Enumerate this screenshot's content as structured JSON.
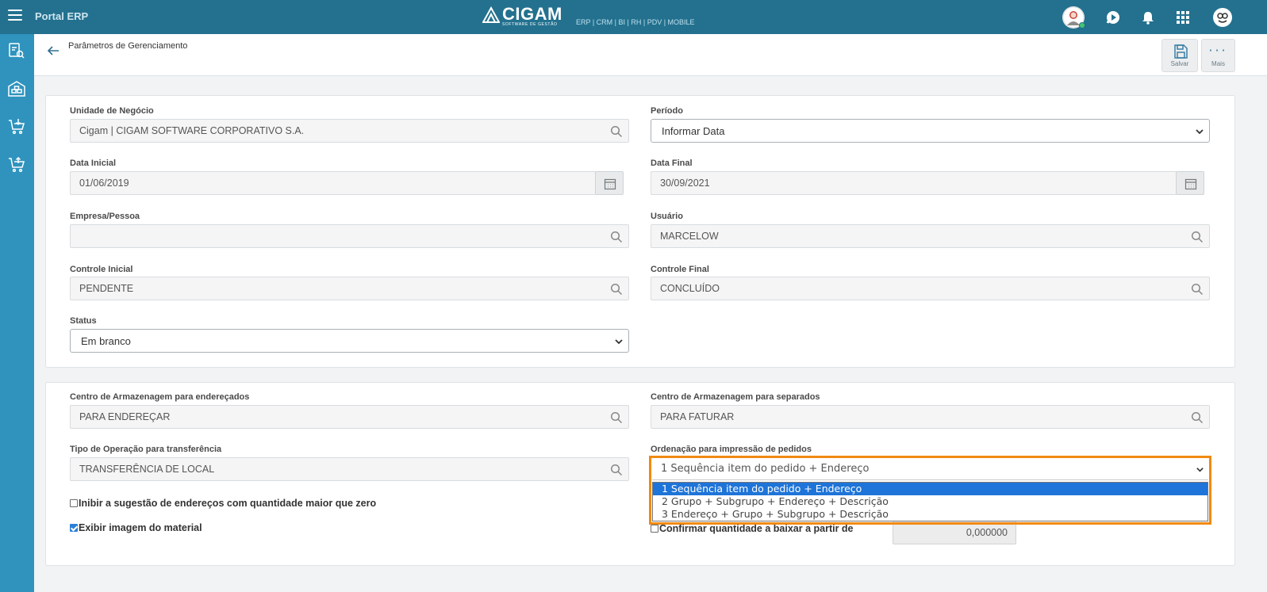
{
  "topbar": {
    "app_title": "Portal ERP",
    "brand_name": "CIGAM",
    "brand_sub": "SOFTWARE DE GESTÃO",
    "modules": "ERP | CRM | BI | RH | PDV | MOBILE",
    "icons": [
      "avatar",
      "chat-play-icon",
      "bell-icon",
      "apps-grid-icon",
      "profile-logo-icon"
    ],
    "bar_color": "#23718f"
  },
  "rail": {
    "color": "#2f93be",
    "icons": [
      "report-search-icon",
      "warehouse-icon",
      "cart-down-icon",
      "cart-up-icon"
    ]
  },
  "header": {
    "title": "Parâmetros de Gerenciamento",
    "save_label": "Salvar",
    "more_label": "Mais"
  },
  "form": {
    "unidade": {
      "label": "Unidade de Negócio",
      "value": "Cigam | CIGAM SOFTWARE CORPORATIVO S.A."
    },
    "periodo": {
      "label": "Período",
      "value": "Informar Data"
    },
    "data_inicial": {
      "label": "Data Inicial",
      "value": "01/06/2019"
    },
    "data_final": {
      "label": "Data Final",
      "value": "30/09/2021"
    },
    "empresa": {
      "label": "Empresa/Pessoa",
      "value": ""
    },
    "usuario": {
      "label": "Usuário",
      "value": "MARCELOW"
    },
    "controle_inicial": {
      "label": "Controle Inicial",
      "value": "PENDENTE"
    },
    "controle_final": {
      "label": "Controle Final",
      "value": "CONCLUÍDO"
    },
    "status": {
      "label": "Status",
      "value": "Em branco"
    }
  },
  "armazenagem": {
    "enderecados": {
      "label": "Centro de Armazenagem para endereçados",
      "value": "PARA ENDEREÇAR"
    },
    "separados": {
      "label": "Centro de Armazenagem para separados",
      "value": "PARA FATURAR"
    },
    "tipo_operacao": {
      "label": "Tipo de Operação para transferência",
      "value": "TRANSFERÊNCIA DE LOCAL"
    },
    "ordenacao": {
      "label": "Ordenação para impressão de pedidos",
      "value": "1 Sequência item do pedido + Endereço",
      "options": [
        "1 Sequência item do pedido + Endereço",
        "2 Grupo + Subgrupo + Endereço + Descrição",
        "3 Endereço + Grupo + Subgrupo + Descrição"
      ]
    },
    "inibir": {
      "label": "Inibir a sugestão de endereços com quantidade maior que zero",
      "checked": false
    },
    "exibir": {
      "label": "Exibir imagem do material",
      "checked": true
    },
    "confirmar": {
      "label": "Confirmar quantidade a baixar a partir de",
      "value": "0,000000"
    }
  }
}
